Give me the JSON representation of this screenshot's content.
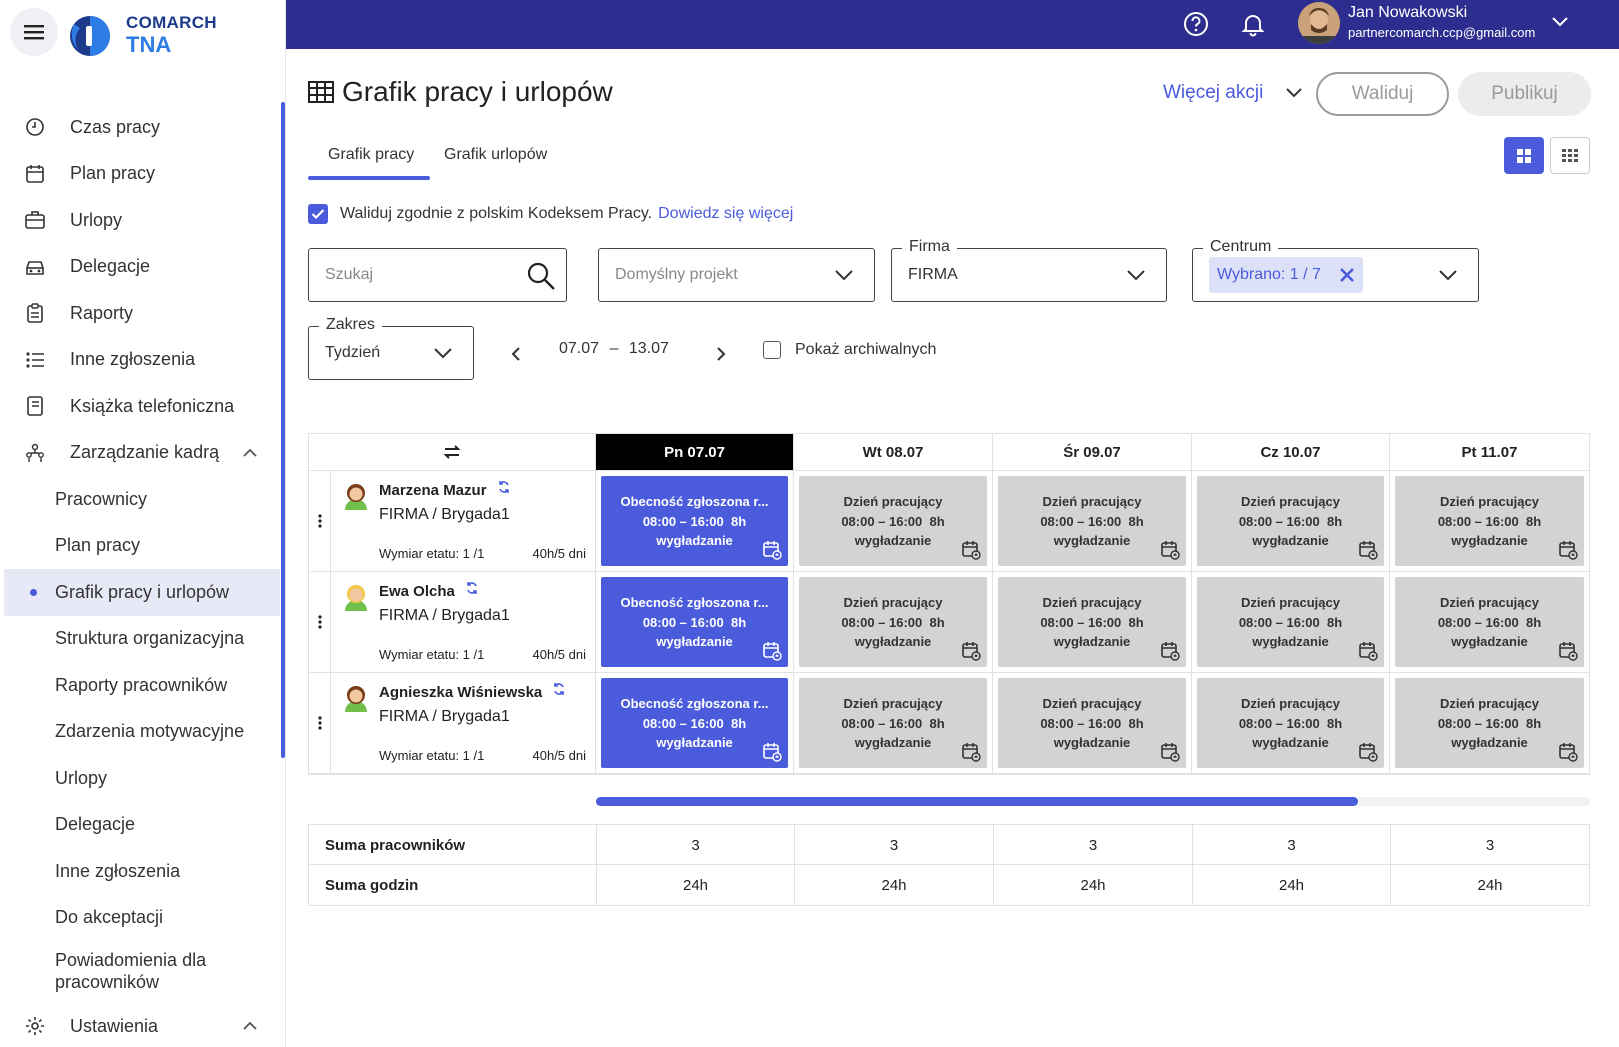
{
  "brand": {
    "line1": "COMARCH",
    "line2": "TNA"
  },
  "user": {
    "name": "Jan Nowakowski",
    "email": "partnercomarch.ccp@gmail.com"
  },
  "sidebar": {
    "items": [
      {
        "label": "Czas pracy",
        "icon": "clock-icon"
      },
      {
        "label": "Plan pracy",
        "icon": "calendar-icon"
      },
      {
        "label": "Urlopy",
        "icon": "suitcase-icon"
      },
      {
        "label": "Delegacje",
        "icon": "car-icon"
      },
      {
        "label": "Raporty",
        "icon": "clipboard-icon"
      },
      {
        "label": "Inne zgłoszenia",
        "icon": "list-icon"
      },
      {
        "label": "Książka telefoniczna",
        "icon": "book-icon"
      },
      {
        "label": "Zarządzanie kadrą",
        "icon": "people-icon"
      }
    ],
    "subitems": [
      {
        "label": "Pracownicy"
      },
      {
        "label": "Plan pracy"
      },
      {
        "label": "Grafik pracy i urlopów"
      },
      {
        "label": "Struktura organizacyjna"
      },
      {
        "label": "Raporty pracowników"
      },
      {
        "label": "Zdarzenia motywacyjne"
      },
      {
        "label": "Urlopy"
      },
      {
        "label": "Delegacje"
      },
      {
        "label": "Inne zgłoszenia"
      },
      {
        "label": "Do akceptacji"
      },
      {
        "label": "Powiadomienia dla pracowników"
      }
    ],
    "settings": {
      "label": "Ustawienia",
      "icon": "gear-icon"
    }
  },
  "page": {
    "title": "Grafik pracy i urlopów",
    "more_actions": "Więcej akcji",
    "validate_btn": "Waliduj",
    "publish_btn": "Publikuj",
    "tabs": [
      "Grafik pracy",
      "Grafik urlopów"
    ],
    "validate_text": "Waliduj zgodnie z polskim Kodeksem Pracy.",
    "validate_link": "Dowiedz się więcej"
  },
  "filters": {
    "search_placeholder": "Szukaj",
    "project_placeholder": "Domyślny projekt",
    "firma_label": "Firma",
    "firma_value": "FIRMA",
    "centrum_label": "Centrum",
    "centrum_chip": "Wybrano: 1 / 7",
    "zakres_label": "Zakres",
    "zakres_value": "Tydzień",
    "date_from": "07.07",
    "date_sep": "–",
    "date_to": "13.07",
    "archive_label": "Pokaż archiwalnych"
  },
  "grid": {
    "days": [
      "Pn 07.07",
      "Wt 08.07",
      "Śr 09.07",
      "Cz 10.07",
      "Pt 11.07"
    ],
    "employees": [
      {
        "name": "Marzena Mazur",
        "org": "FIRMA / Brygada1",
        "wymiar": "Wymiar etatu: 1 /1",
        "hours": "40h/5 dni"
      },
      {
        "name": "Ewa Olcha",
        "org": "FIRMA / Brygada1",
        "wymiar": "Wymiar etatu: 1 /1",
        "hours": "40h/5 dni"
      },
      {
        "name": "Agnieszka Wiśniewska",
        "org": "FIRMA / Brygada1",
        "wymiar": "Wymiar etatu: 1 /1",
        "hours": "40h/5 dni"
      }
    ],
    "cell_first": {
      "title": "Obecność zgłoszona r...",
      "time": "08:00 – 16:00  8h",
      "note": "wygładzanie"
    },
    "cell_other": {
      "title": "Dzień pracujący",
      "time": "08:00 – 16:00  8h",
      "note": "wygładzanie"
    }
  },
  "summary": {
    "rows": [
      {
        "label": "Suma pracowników",
        "values": [
          "3",
          "3",
          "3",
          "3",
          "3"
        ]
      },
      {
        "label": "Suma godzin",
        "values": [
          "24h",
          "24h",
          "24h",
          "24h",
          "24h"
        ]
      }
    ]
  },
  "colors": {
    "accent": "#4a5bdb",
    "header": "#2d2d8f",
    "cell_grey": "#d3d3d3"
  }
}
